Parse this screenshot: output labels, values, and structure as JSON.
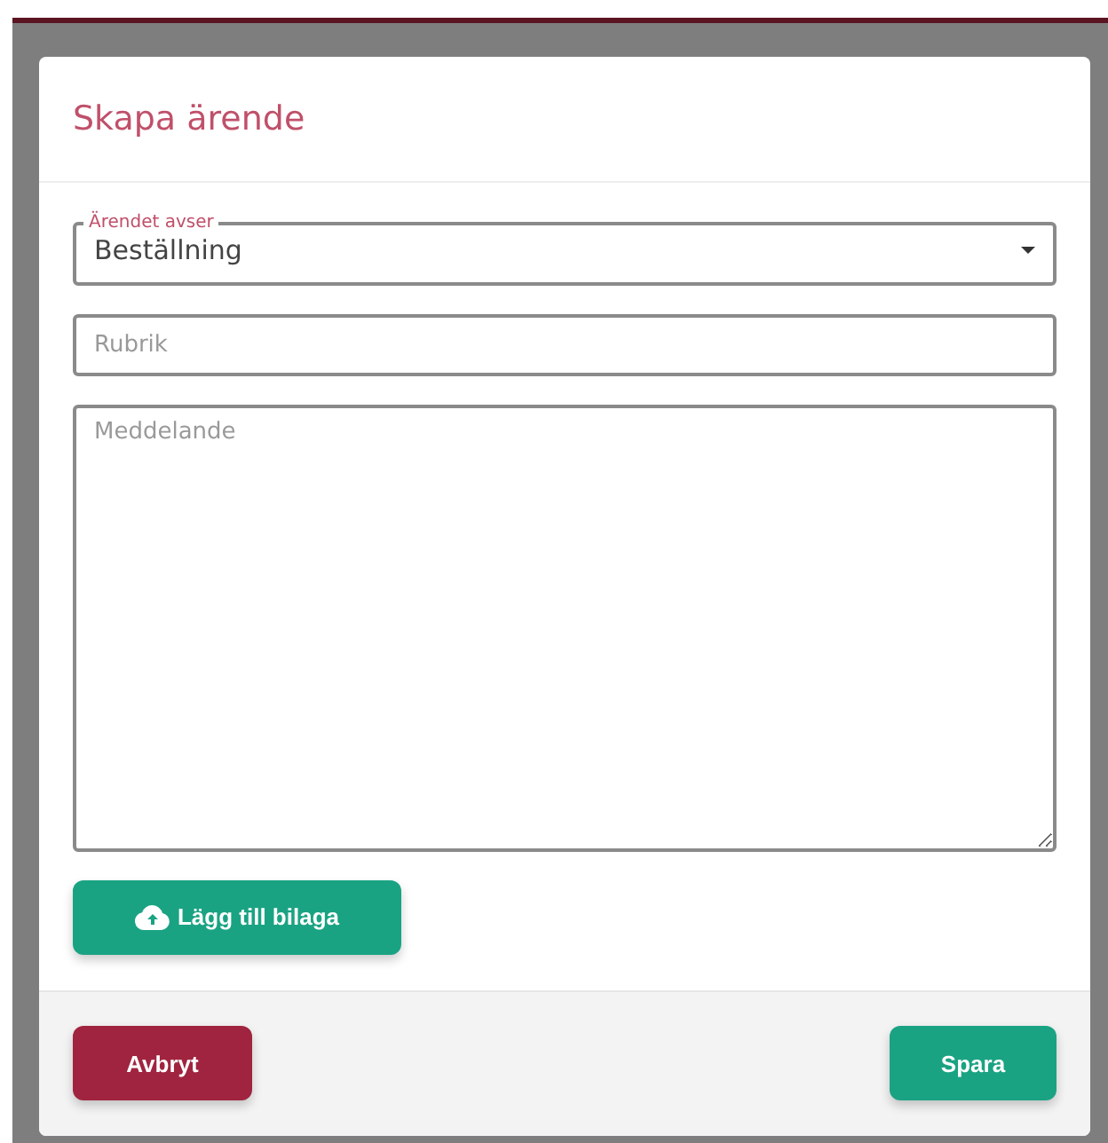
{
  "dialog": {
    "title": "Skapa ärende",
    "select": {
      "label": "Ärendet avser",
      "value": "Beställning"
    },
    "subject": {
      "placeholder": "Rubrik"
    },
    "message": {
      "placeholder": "Meddelande"
    },
    "attach_button": "Lägg till bilaga",
    "cancel_button": "Avbryt",
    "save_button": "Spara"
  }
}
